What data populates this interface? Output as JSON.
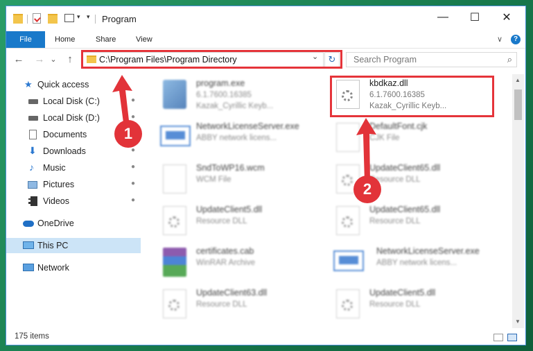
{
  "window": {
    "title": "Program",
    "minimize_glyph": "—",
    "maximize_glyph": "☐",
    "close_glyph": "✕"
  },
  "ribbon": {
    "tabs": [
      "File",
      "Home",
      "Share",
      "View"
    ],
    "expand_glyph": "∨",
    "help_glyph": "?"
  },
  "nav": {
    "back_glyph": "←",
    "forward_glyph": "→",
    "recent_glyph": "⌄",
    "up_glyph": "↑",
    "address": "C:\\Program Files\\Program Directory",
    "address_chevron": "⌄",
    "refresh_glyph": "↻",
    "search_placeholder": "Search Program",
    "search_glyph": "⌕"
  },
  "sidebar": {
    "items": [
      {
        "label": "Quick access",
        "icon": "star-icon",
        "pinned": false
      },
      {
        "label": "Local Disk (C:)",
        "icon": "drive-icon",
        "pinned": true
      },
      {
        "label": "Local Disk (D:)",
        "icon": "drive-icon",
        "pinned": true
      },
      {
        "label": "Documents",
        "icon": "documents-icon",
        "pinned": true
      },
      {
        "label": "Downloads",
        "icon": "download-icon",
        "pinned": true
      },
      {
        "label": "Music",
        "icon": "music-icon",
        "pinned": true
      },
      {
        "label": "Pictures",
        "icon": "pictures-icon",
        "pinned": true
      },
      {
        "label": "Videos",
        "icon": "videos-icon",
        "pinned": true
      },
      {
        "label": "OneDrive",
        "icon": "cloud-icon",
        "pinned": false
      },
      {
        "label": "This PC",
        "icon": "pc-icon",
        "pinned": false
      },
      {
        "label": "Network",
        "icon": "network-icon",
        "pinned": false
      }
    ],
    "pin_glyph": "📌"
  },
  "files": [
    {
      "name": "program.exe",
      "line1": "6.1.7600.16385",
      "line2": "Kazak_Cyrillic Keyb...",
      "icon": "installer-icon",
      "blurred": true
    },
    {
      "name": "kbdkaz.dll",
      "line1": "6.1.7600.16385",
      "line2": "Kazak_Cyrillic Keyb...",
      "icon": "dll-gear-icon",
      "blurred": false
    },
    {
      "name": "NetworkLicenseServer.exe",
      "line1": "ABBY network licens...",
      "line2": "",
      "icon": "exe-window-icon",
      "blurred": true
    },
    {
      "name": "DefaultFont.cjk",
      "line1": "CJK File",
      "line2": "",
      "icon": "blank-file-icon",
      "blurred": true
    },
    {
      "name": "SndToWP16.wcm",
      "line1": "WCM File",
      "line2": "",
      "icon": "blank-file-icon",
      "blurred": true
    },
    {
      "name": "UpdateClient65.dll",
      "line1": "Resource DLL",
      "line2": "",
      "icon": "dll-gear-icon",
      "blurred": true
    },
    {
      "name": "UpdateClient5.dll",
      "line1": "Resource DLL",
      "line2": "",
      "icon": "dll-gear-icon",
      "blurred": true
    },
    {
      "name": "UpdateClient65.dll",
      "line1": "Resource DLL",
      "line2": "",
      "icon": "dll-gear-icon",
      "blurred": true
    },
    {
      "name": "certificates.cab",
      "line1": "WinRAR Archive",
      "line2": "",
      "icon": "winrar-icon",
      "blurred": true
    },
    {
      "name": "NetworkLicenseServer.exe",
      "line1": "ABBY network licens...",
      "line2": "",
      "icon": "exe-window-icon",
      "blurred": true
    },
    {
      "name": "UpdateClient63.dll",
      "line1": "Resource DLL",
      "line2": "",
      "icon": "dll-gear-icon",
      "blurred": true
    },
    {
      "name": "UpdateClient5.dll",
      "line1": "Resource DLL",
      "line2": "",
      "icon": "dll-gear-icon",
      "blurred": true
    }
  ],
  "status": {
    "count": "175 items"
  },
  "callouts": [
    "1",
    "2"
  ],
  "colors": {
    "accent": "#1979ca",
    "callout": "#e23339",
    "selected": "#cce4f7"
  }
}
